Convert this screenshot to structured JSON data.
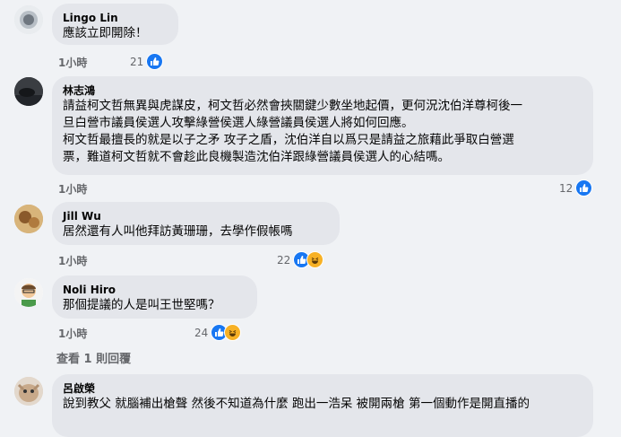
{
  "comments": [
    {
      "author": "Lingo Lin",
      "lines": [
        "應該立即開除！"
      ],
      "time": "1小時",
      "reaction_count": "21",
      "reactions": [
        "like"
      ]
    },
    {
      "author": "林志鴻",
      "lines": [
        "請益柯文哲無異與虎謀皮，柯文哲必然會挾關鍵少數坐地起價，更何況沈伯洋尊柯後一",
        "旦白營市議員侯選人攻擊綠營侯選人綠營議員侯選人將如何回應。",
        "柯文哲最擅長的就是以子之矛 攻子之盾，沈伯洋自以爲只是請益之旅藉此爭取白營選",
        "票，難道柯文哲就不會趁此良機製造沈伯洋跟綠營議員侯選人的心結嗎。"
      ],
      "time": "1小時",
      "reaction_count": "12",
      "reactions": [
        "like"
      ]
    },
    {
      "author": "Jill Wu",
      "lines": [
        "居然還有人叫他拜訪黃珊珊，去學作假帳嗎"
      ],
      "time": "1小時",
      "reaction_count": "22",
      "reactions": [
        "like",
        "haha"
      ]
    },
    {
      "author": "Noli Hiro",
      "lines": [
        "那個提議的人是叫王世堅嗎？"
      ],
      "time": "1小時",
      "reaction_count": "24",
      "reactions": [
        "like",
        "haha"
      ]
    },
    {
      "author": "呂啟榮",
      "lines": [
        "說到教父 就腦補出槍聲 然後不知道為什麼 跑出一浩呆 被開兩槍 第一個動作是開直播的"
      ],
      "time": "",
      "reaction_count": "",
      "reactions": []
    }
  ],
  "view_replies": "查看 1 則回覆",
  "colors": {
    "like": "#1877f2",
    "haha": "#f7b125",
    "bubble": "#e4e6eb",
    "background": "#f0f2f5"
  }
}
